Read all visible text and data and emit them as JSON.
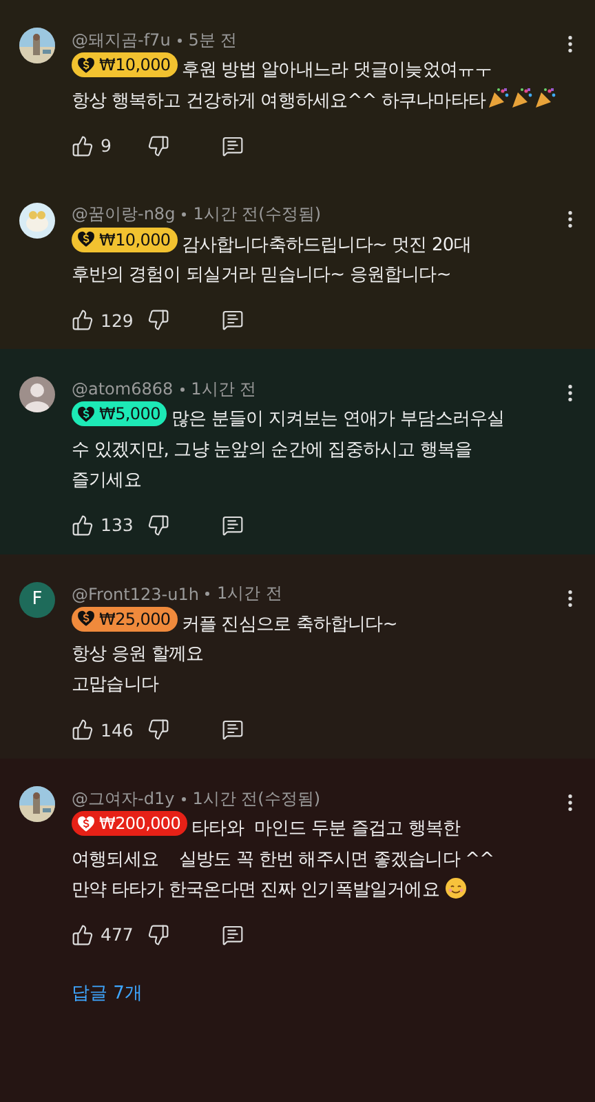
{
  "comments": [
    {
      "author": "@돼지곰-f7u",
      "time": "5분 전",
      "avatar": {
        "kind": "picture"
      },
      "super_chat": {
        "amount": "₩10,000",
        "color": "#f2c230"
      },
      "lines": [
        "후원 방법 알아내느라 댓글이늦었여ㅠㅜ",
        "항상 행복하고 건강하게 여행하세요^^ 하쿠나마타타"
      ],
      "trailing_icons": [
        {
          "kind": "party"
        },
        {
          "kind": "party"
        },
        {
          "kind": "party"
        }
      ],
      "likes": "9"
    },
    {
      "author": "@꿈이랑-n8g",
      "time": "1시간 전(수정됨)",
      "avatar": {
        "kind": "cartoon"
      },
      "super_chat": {
        "amount": "₩10,000",
        "color": "#f2c230"
      },
      "lines": [
        "감사합니다축하드립니다~ 멋진 20대",
        "후반의 경험이 되실거라 믿습니다~ 응원합니다~"
      ],
      "likes": "129"
    },
    {
      "author": "@atom6868",
      "time": "1시간 전",
      "avatar": {
        "kind": "silhouette"
      },
      "super_chat": {
        "amount": "₩5,000",
        "color": "#1de9b6"
      },
      "lines": [
        "많은 분들이 지켜보는 연애가 부담스러우실",
        "수 있겠지만, 그냥 눈앞의 순간에 집중하시고 행복을",
        "즐기세요"
      ],
      "likes": "133"
    },
    {
      "author": "@Front123-u1h",
      "time": "1시간 전",
      "avatar": {
        "kind": "letter",
        "letter": "F"
      },
      "super_chat": {
        "amount": "₩25,000",
        "color": "#f08a3c"
      },
      "lines": [
        "커플 진심으로 축하합니다~",
        "항상 응원 할께요",
        "고맙습니다"
      ],
      "likes": "146"
    },
    {
      "author": "@그여자-d1y",
      "time": "1시간 전(수정됨)",
      "avatar": {
        "kind": "picture"
      },
      "super_chat": {
        "amount": "₩200,000",
        "color": "#e62117"
      },
      "lines": [
        "타타와  마인드 두분 즐겁고 행복한",
        "여행되세요    실방도 꼭 한번 해주시면 좋겠습니다 ^^",
        "만약 타타가 한국온다면 진짜 인기폭발일거에요"
      ],
      "trailing_icons": [
        {
          "kind": "smile"
        }
      ],
      "likes": "477",
      "replies": "답글 7개"
    }
  ]
}
